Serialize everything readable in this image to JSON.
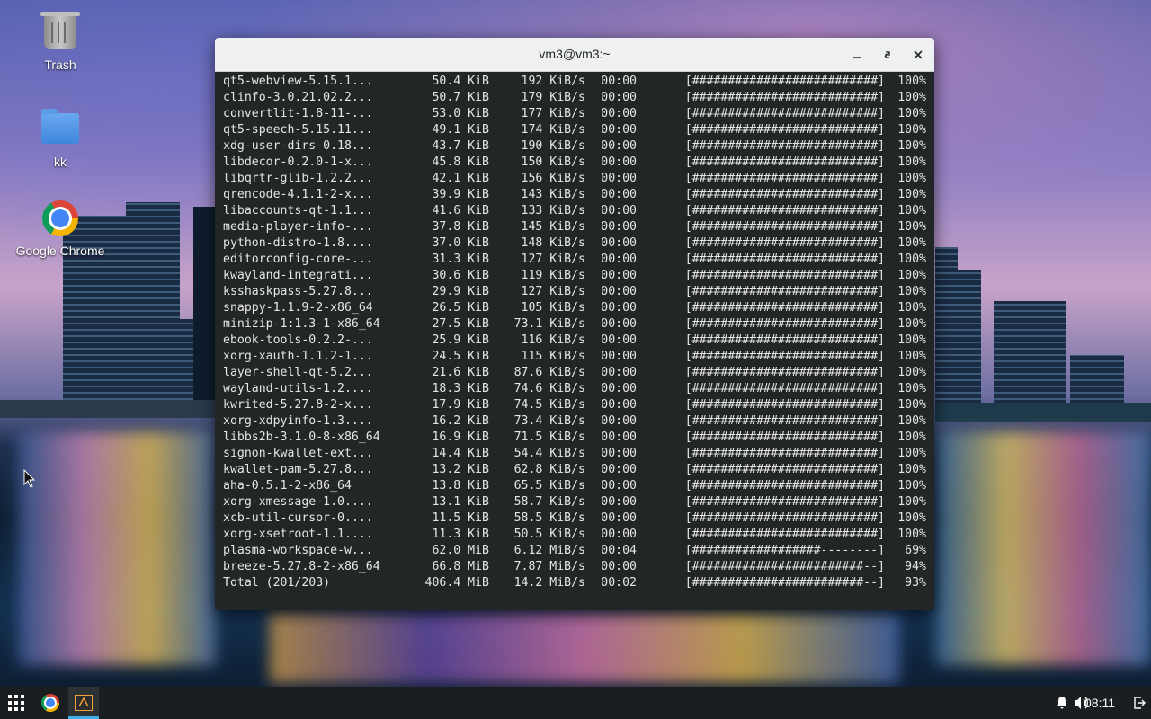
{
  "desktop": {
    "icons": [
      {
        "label": "Trash",
        "icon": "trash-icon"
      },
      {
        "label": "kk",
        "icon": "folder-icon"
      },
      {
        "label": "Google Chrome",
        "icon": "chrome-icon"
      }
    ]
  },
  "window": {
    "title": "vm3@vm3:~",
    "buttons": {
      "minimize": "minimize-icon",
      "maximize": "maximize-icon",
      "close": "close-icon"
    }
  },
  "terminal": {
    "rows": [
      {
        "name": "qt5-webview-5.15.1...",
        "size": "50.4 KiB",
        "rate": "192 KiB/s",
        "time": "00:00",
        "bar": "[##########################]",
        "pct": "100%"
      },
      {
        "name": "clinfo-3.0.21.02.2...",
        "size": "50.7 KiB",
        "rate": "179 KiB/s",
        "time": "00:00",
        "bar": "[##########################]",
        "pct": "100%"
      },
      {
        "name": "convertlit-1.8-11-...",
        "size": "53.0 KiB",
        "rate": "177 KiB/s",
        "time": "00:00",
        "bar": "[##########################]",
        "pct": "100%"
      },
      {
        "name": "qt5-speech-5.15.11...",
        "size": "49.1 KiB",
        "rate": "174 KiB/s",
        "time": "00:00",
        "bar": "[##########################]",
        "pct": "100%"
      },
      {
        "name": "xdg-user-dirs-0.18...",
        "size": "43.7 KiB",
        "rate": "190 KiB/s",
        "time": "00:00",
        "bar": "[##########################]",
        "pct": "100%"
      },
      {
        "name": "libdecor-0.2.0-1-x...",
        "size": "45.8 KiB",
        "rate": "150 KiB/s",
        "time": "00:00",
        "bar": "[##########################]",
        "pct": "100%"
      },
      {
        "name": "libqrtr-glib-1.2.2...",
        "size": "42.1 KiB",
        "rate": "156 KiB/s",
        "time": "00:00",
        "bar": "[##########################]",
        "pct": "100%"
      },
      {
        "name": "qrencode-4.1.1-2-x...",
        "size": "39.9 KiB",
        "rate": "143 KiB/s",
        "time": "00:00",
        "bar": "[##########################]",
        "pct": "100%"
      },
      {
        "name": "libaccounts-qt-1.1...",
        "size": "41.6 KiB",
        "rate": "133 KiB/s",
        "time": "00:00",
        "bar": "[##########################]",
        "pct": "100%"
      },
      {
        "name": "media-player-info-...",
        "size": "37.8 KiB",
        "rate": "145 KiB/s",
        "time": "00:00",
        "bar": "[##########################]",
        "pct": "100%"
      },
      {
        "name": "python-distro-1.8....",
        "size": "37.0 KiB",
        "rate": "148 KiB/s",
        "time": "00:00",
        "bar": "[##########################]",
        "pct": "100%"
      },
      {
        "name": "editorconfig-core-...",
        "size": "31.3 KiB",
        "rate": "127 KiB/s",
        "time": "00:00",
        "bar": "[##########################]",
        "pct": "100%"
      },
      {
        "name": "kwayland-integrati...",
        "size": "30.6 KiB",
        "rate": "119 KiB/s",
        "time": "00:00",
        "bar": "[##########################]",
        "pct": "100%"
      },
      {
        "name": "ksshaskpass-5.27.8...",
        "size": "29.9 KiB",
        "rate": "127 KiB/s",
        "time": "00:00",
        "bar": "[##########################]",
        "pct": "100%"
      },
      {
        "name": "snappy-1.1.9-2-x86_64",
        "size": "26.5 KiB",
        "rate": "105 KiB/s",
        "time": "00:00",
        "bar": "[##########################]",
        "pct": "100%"
      },
      {
        "name": "minizip-1:1.3-1-x86_64",
        "size": "27.5 KiB",
        "rate": "73.1 KiB/s",
        "time": "00:00",
        "bar": "[##########################]",
        "pct": "100%"
      },
      {
        "name": "ebook-tools-0.2.2-...",
        "size": "25.9 KiB",
        "rate": "116 KiB/s",
        "time": "00:00",
        "bar": "[##########################]",
        "pct": "100%"
      },
      {
        "name": "xorg-xauth-1.1.2-1...",
        "size": "24.5 KiB",
        "rate": "115 KiB/s",
        "time": "00:00",
        "bar": "[##########################]",
        "pct": "100%"
      },
      {
        "name": "layer-shell-qt-5.2...",
        "size": "21.6 KiB",
        "rate": "87.6 KiB/s",
        "time": "00:00",
        "bar": "[##########################]",
        "pct": "100%"
      },
      {
        "name": "wayland-utils-1.2....",
        "size": "18.3 KiB",
        "rate": "74.6 KiB/s",
        "time": "00:00",
        "bar": "[##########################]",
        "pct": "100%"
      },
      {
        "name": "kwrited-5.27.8-2-x...",
        "size": "17.9 KiB",
        "rate": "74.5 KiB/s",
        "time": "00:00",
        "bar": "[##########################]",
        "pct": "100%"
      },
      {
        "name": "xorg-xdpyinfo-1.3....",
        "size": "16.2 KiB",
        "rate": "73.4 KiB/s",
        "time": "00:00",
        "bar": "[##########################]",
        "pct": "100%"
      },
      {
        "name": "libbs2b-3.1.0-8-x86_64",
        "size": "16.9 KiB",
        "rate": "71.5 KiB/s",
        "time": "00:00",
        "bar": "[##########################]",
        "pct": "100%"
      },
      {
        "name": "signon-kwallet-ext...",
        "size": "14.4 KiB",
        "rate": "54.4 KiB/s",
        "time": "00:00",
        "bar": "[##########################]",
        "pct": "100%"
      },
      {
        "name": "kwallet-pam-5.27.8...",
        "size": "13.2 KiB",
        "rate": "62.8 KiB/s",
        "time": "00:00",
        "bar": "[##########################]",
        "pct": "100%"
      },
      {
        "name": "aha-0.5.1-2-x86_64",
        "size": "13.8 KiB",
        "rate": "65.5 KiB/s",
        "time": "00:00",
        "bar": "[##########################]",
        "pct": "100%"
      },
      {
        "name": "xorg-xmessage-1.0....",
        "size": "13.1 KiB",
        "rate": "58.7 KiB/s",
        "time": "00:00",
        "bar": "[##########################]",
        "pct": "100%"
      },
      {
        "name": "xcb-util-cursor-0....",
        "size": "11.5 KiB",
        "rate": "58.5 KiB/s",
        "time": "00:00",
        "bar": "[##########################]",
        "pct": "100%"
      },
      {
        "name": "xorg-xsetroot-1.1....",
        "size": "11.3 KiB",
        "rate": "50.5 KiB/s",
        "time": "00:00",
        "bar": "[##########################]",
        "pct": "100%"
      },
      {
        "name": "plasma-workspace-w...",
        "size": "62.0 MiB",
        "rate": "6.12 MiB/s",
        "time": "00:04",
        "bar": "[##################--------]",
        "pct": "69%"
      },
      {
        "name": "breeze-5.27.8-2-x86_64",
        "size": "66.8 MiB",
        "rate": "7.87 MiB/s",
        "time": "00:00",
        "bar": "[########################--]",
        "pct": "94%"
      },
      {
        "name": "Total (201/203)",
        "size": "406.4 MiB",
        "rate": "14.2 MiB/s",
        "time": "00:02",
        "bar": "[########################--]",
        "pct": "93%"
      }
    ]
  },
  "panel": {
    "launcher_icon": "app-launcher-icon",
    "tasks": [
      "chrome-icon",
      "terminal-icon"
    ],
    "tray": [
      "notifications-icon",
      "volume-icon"
    ],
    "clock": "08:11",
    "show_desktop_icon": "show-desktop-icon",
    "accent": "#3daee9"
  }
}
